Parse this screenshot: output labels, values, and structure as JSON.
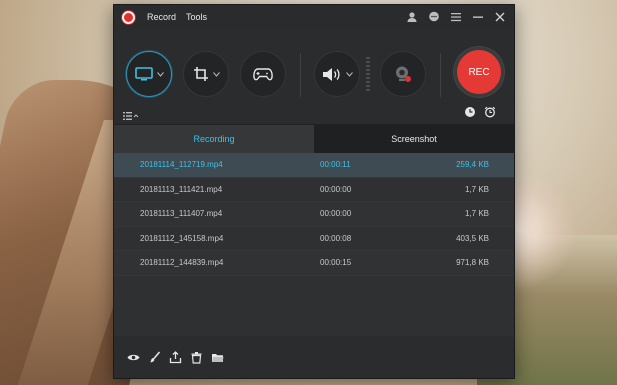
{
  "menu": {
    "record": "Record",
    "tools": "Tools"
  },
  "toolbar": {
    "rec_label": "REC"
  },
  "tabs": [
    {
      "label": "Recording"
    },
    {
      "label": "Screenshot"
    }
  ],
  "files": [
    {
      "name": "20181114_112719.mp4",
      "duration": "00:00:11",
      "size": "259,4 KB"
    },
    {
      "name": "20181113_111421.mp4",
      "duration": "00:00:00",
      "size": "1,7 KB"
    },
    {
      "name": "20181113_111407.mp4",
      "duration": "00:00:00",
      "size": "1,7 KB"
    },
    {
      "name": "20181112_145158.mp4",
      "duration": "00:00:08",
      "size": "403,5 KB"
    },
    {
      "name": "20181112_144839.mp4",
      "duration": "00:00:15",
      "size": "971,8 KB"
    }
  ],
  "colors": {
    "accent": "#3cc2e6",
    "rec": "#e53935"
  },
  "icons": [
    "user-icon",
    "chat-icon",
    "menu-icon",
    "minimize-icon",
    "close-icon",
    "monitor-icon",
    "crop-icon",
    "gamepad-icon",
    "speaker-icon",
    "webcam-icon",
    "timer-icon",
    "alarm-icon",
    "eye-icon",
    "brush-icon",
    "share-icon",
    "trash-icon",
    "folder-icon"
  ]
}
